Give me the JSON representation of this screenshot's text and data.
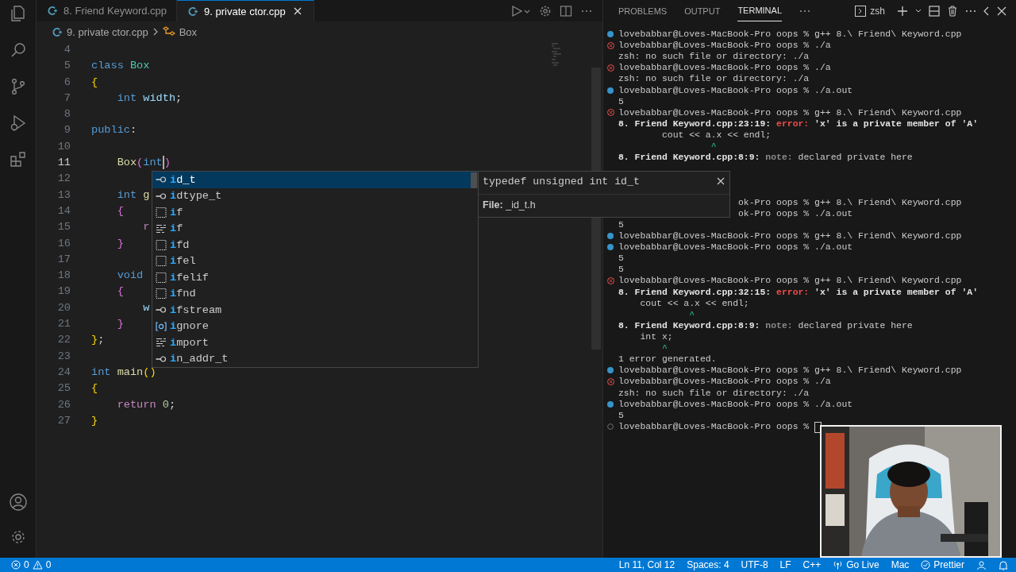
{
  "tabs": [
    {
      "label": "8. Friend Keyword.cpp",
      "selected": false
    },
    {
      "label": "9. private ctor.cpp",
      "selected": true
    }
  ],
  "breadcrumbs": {
    "file": "9. private ctor.cpp",
    "symbol": "Box"
  },
  "code_lines": [
    {
      "number": "4",
      "current": false
    },
    {
      "number": "5",
      "current": false,
      "tokens": [
        {
          "kind": "keyword",
          "text": "class"
        },
        {
          "kind": "type",
          "text": " Box"
        }
      ]
    },
    {
      "number": "6",
      "current": false,
      "tokens": [
        {
          "kind": "bracket1",
          "text": "{"
        }
      ]
    },
    {
      "number": "7",
      "current": false,
      "tokens": [
        {
          "kind": "keyword",
          "text": "    int"
        },
        {
          "kind": "var",
          "text": " width"
        },
        {
          "kind": "plain",
          "text": ";"
        }
      ]
    },
    {
      "number": "8",
      "current": false
    },
    {
      "number": "9",
      "current": false,
      "tokens": [
        {
          "kind": "keyword",
          "text": "public"
        },
        {
          "kind": "plain",
          "text": ":"
        }
      ]
    },
    {
      "number": "10",
      "current": false
    },
    {
      "number": "11",
      "current": true,
      "tokens": [
        {
          "kind": "func",
          "text": "    Box"
        },
        {
          "kind": "bracket2",
          "text": "("
        },
        {
          "kind": "keyword",
          "text": "int",
          "cursor": true
        },
        {
          "kind": "bracket2",
          "text": ")"
        }
      ]
    },
    {
      "number": "12",
      "current": false
    },
    {
      "number": "13",
      "current": false,
      "tokens": [
        {
          "kind": "keyword",
          "text": "    int"
        },
        {
          "kind": "func",
          "text": " g"
        }
      ]
    },
    {
      "number": "14",
      "current": false,
      "tokens": [
        {
          "kind": "bracket2",
          "text": "    {"
        }
      ]
    },
    {
      "number": "15",
      "current": false,
      "tokens": [
        {
          "kind": "control",
          "text": "        r"
        }
      ]
    },
    {
      "number": "16",
      "current": false,
      "tokens": [
        {
          "kind": "bracket2",
          "text": "    }"
        }
      ]
    },
    {
      "number": "17",
      "current": false
    },
    {
      "number": "18",
      "current": false,
      "tokens": [
        {
          "kind": "keyword",
          "text": "    void"
        }
      ]
    },
    {
      "number": "19",
      "current": false,
      "tokens": [
        {
          "kind": "bracket2",
          "text": "    {"
        }
      ]
    },
    {
      "number": "20",
      "current": false,
      "tokens": [
        {
          "kind": "var",
          "text": "        w"
        }
      ]
    },
    {
      "number": "21",
      "current": false,
      "tokens": [
        {
          "kind": "bracket2",
          "text": "    }"
        }
      ]
    },
    {
      "number": "22",
      "current": false,
      "tokens": [
        {
          "kind": "bracket1",
          "text": "}"
        },
        {
          "kind": "plain",
          "text": ";"
        }
      ]
    },
    {
      "number": "23",
      "current": false
    },
    {
      "number": "24",
      "current": false,
      "tokens": [
        {
          "kind": "keyword",
          "text": "int"
        },
        {
          "kind": "func",
          "text": " main"
        },
        {
          "kind": "bracket1",
          "text": "()"
        }
      ]
    },
    {
      "number": "25",
      "current": false,
      "tokens": [
        {
          "kind": "bracket1",
          "text": "{"
        }
      ]
    },
    {
      "number": "26",
      "current": false,
      "tokens": [
        {
          "kind": "control",
          "text": "    return"
        },
        {
          "kind": "num",
          "text": " 0"
        },
        {
          "kind": "plain",
          "text": ";"
        }
      ]
    },
    {
      "number": "27",
      "current": false,
      "tokens": [
        {
          "kind": "bracket1",
          "text": "}"
        }
      ]
    }
  ],
  "suggestions": [
    {
      "label": "**i**d_t",
      "kind": "typedef",
      "selected": true
    },
    {
      "label": "**i**dtype_t",
      "kind": "typedef",
      "selected": false
    },
    {
      "label": "**i**f",
      "kind": "snippet",
      "selected": false
    },
    {
      "label": "**i**f",
      "kind": "keyword",
      "selected": false
    },
    {
      "label": "**i**fd",
      "kind": "snippet",
      "selected": false
    },
    {
      "label": "**i**fel",
      "kind": "snippet",
      "selected": false
    },
    {
      "label": "**i**felif",
      "kind": "snippet",
      "selected": false
    },
    {
      "label": "**i**fnd",
      "kind": "snippet",
      "selected": false
    },
    {
      "label": "**i**fstream",
      "kind": "typedef",
      "selected": false
    },
    {
      "label": "**i**gnore",
      "kind": "variable",
      "selected": false
    },
    {
      "label": "**i**mport",
      "kind": "keyword",
      "selected": false
    },
    {
      "label": "**i**n_addr_t",
      "kind": "typedef",
      "selected": false
    }
  ],
  "details": {
    "signature": "typedef unsigned int id_t",
    "file": "**File:** _id_t.h"
  },
  "panel": {
    "tabs": [
      {
        "label": "PROBLEMS",
        "selected": false
      },
      {
        "label": "OUTPUT",
        "selected": false
      },
      {
        "label": "TERMINAL",
        "selected": true
      }
    ],
    "shell": "zsh"
  },
  "terminal": [
    {
      "kind": "ok",
      "segments": [
        {
          "text": "lovebabbar@Loves-MacBook-Pro oops % g++ 8.\\ Friend\\ Keyword.cpp"
        }
      ]
    },
    {
      "kind": "error",
      "segments": [
        {
          "text": "lovebabbar@Loves-MacBook-Pro oops % ./a"
        }
      ]
    },
    {
      "kind": "output",
      "segments": [
        {
          "text": "zsh: no such file or directory: ./a"
        }
      ]
    },
    {
      "kind": "error",
      "segments": [
        {
          "text": "lovebabbar@Loves-MacBook-Pro oops % ./a"
        }
      ]
    },
    {
      "kind": "output",
      "segments": [
        {
          "text": "zsh: no such file or directory: ./a"
        }
      ]
    },
    {
      "kind": "ok",
      "segments": [
        {
          "text": "lovebabbar@Loves-MacBook-Pro oops % ./a.out"
        }
      ]
    },
    {
      "kind": "output",
      "segments": [
        {
          "text": "5"
        }
      ]
    },
    {
      "kind": "error",
      "segments": [
        {
          "text": "lovebabbar@Loves-MacBook-Pro oops % g++ 8.\\ Friend\\ Keyword.cpp"
        }
      ]
    },
    {
      "kind": "output",
      "segments": [
        {
          "kind": "bold",
          "text": "8. Friend Keyword.cpp:23:19: "
        },
        {
          "kind": "error",
          "text": "error: "
        },
        {
          "kind": "bold",
          "text": "'x' is a private member of 'A'"
        }
      ]
    },
    {
      "kind": "output",
      "segments": [
        {
          "text": "        cout << a.x << endl;"
        }
      ]
    },
    {
      "kind": "output",
      "segments": [
        {
          "kind": "caret",
          "text": "                 ^"
        }
      ]
    },
    {
      "kind": "output",
      "segments": [
        {
          "kind": "bold",
          "text": "8. Friend Keyword.cpp:8:9: "
        },
        {
          "kind": "note",
          "text": "note: "
        },
        {
          "text": "declared private here"
        }
      ]
    },
    {
      "kind": "blank"
    },
    {
      "kind": "blank"
    },
    {
      "kind": "blank"
    },
    {
      "kind": "covered",
      "segments": [
        {
          "text": "ok-Pro oops % g++ 8.\\ Friend\\ Keyword.cpp"
        }
      ]
    },
    {
      "kind": "covered",
      "segments": [
        {
          "text": "ok-Pro oops % ./a.out"
        }
      ]
    },
    {
      "kind": "output",
      "segments": [
        {
          "text": "5"
        }
      ]
    },
    {
      "kind": "ok",
      "segments": [
        {
          "text": "lovebabbar@Loves-MacBook-Pro oops % g++ 8.\\ Friend\\ Keyword.cpp"
        }
      ]
    },
    {
      "kind": "ok",
      "segments": [
        {
          "text": "lovebabbar@Loves-MacBook-Pro oops % ./a.out"
        }
      ]
    },
    {
      "kind": "output",
      "segments": [
        {
          "text": "5"
        }
      ]
    },
    {
      "kind": "output",
      "segments": [
        {
          "text": "5"
        }
      ]
    },
    {
      "kind": "error",
      "segments": [
        {
          "text": "lovebabbar@Loves-MacBook-Pro oops % g++ 8.\\ Friend\\ Keyword.cpp"
        }
      ]
    },
    {
      "kind": "output",
      "segments": [
        {
          "kind": "bold",
          "text": "8. Friend Keyword.cpp:32:15: "
        },
        {
          "kind": "error",
          "text": "error: "
        },
        {
          "kind": "bold",
          "text": "'x' is a private member of 'A'"
        }
      ]
    },
    {
      "kind": "output",
      "segments": [
        {
          "text": "    cout << a.x << endl;"
        }
      ]
    },
    {
      "kind": "output",
      "segments": [
        {
          "kind": "caret",
          "text": "             ^"
        }
      ]
    },
    {
      "kind": "output",
      "segments": [
        {
          "kind": "bold",
          "text": "8. Friend Keyword.cpp:8:9: "
        },
        {
          "kind": "note",
          "text": "note: "
        },
        {
          "text": "declared private here"
        }
      ]
    },
    {
      "kind": "output",
      "segments": [
        {
          "text": "    int x;"
        }
      ]
    },
    {
      "kind": "output",
      "segments": [
        {
          "kind": "caret",
          "text": "        ^"
        }
      ]
    },
    {
      "kind": "output",
      "segments": [
        {
          "text": "1 error generated."
        }
      ]
    },
    {
      "kind": "ok",
      "segments": [
        {
          "text": "lovebabbar@Loves-MacBook-Pro oops % g++ 8.\\ Friend\\ Keyword.cpp"
        }
      ]
    },
    {
      "kind": "error",
      "segments": [
        {
          "text": "lovebabbar@Loves-MacBook-Pro oops % ./a"
        }
      ]
    },
    {
      "kind": "output",
      "segments": [
        {
          "text": "zsh: no such file or directory: ./a"
        }
      ]
    },
    {
      "kind": "ok",
      "segments": [
        {
          "text": "lovebabbar@Loves-MacBook-Pro oops % ./a.out"
        }
      ]
    },
    {
      "kind": "output",
      "segments": [
        {
          "text": "5"
        }
      ]
    },
    {
      "kind": "idle",
      "cursor": true,
      "segments": [
        {
          "text": "lovebabbar@Loves-MacBook-Pro oops % "
        }
      ]
    }
  ],
  "status_bar": {
    "errors": "0",
    "warnings": "0",
    "items": [
      {
        "kind": "text",
        "text": "Ln 11, Col 12"
      },
      {
        "kind": "text",
        "text": "Spaces: 4"
      },
      {
        "kind": "text",
        "text": "UTF-8"
      },
      {
        "kind": "text",
        "text": "LF"
      },
      {
        "kind": "text",
        "text": "C++"
      },
      {
        "kind": "go-live",
        "text": "Go Live"
      },
      {
        "kind": "text",
        "text": "Mac"
      },
      {
        "kind": "prettier",
        "text": "Prettier"
      }
    ]
  }
}
